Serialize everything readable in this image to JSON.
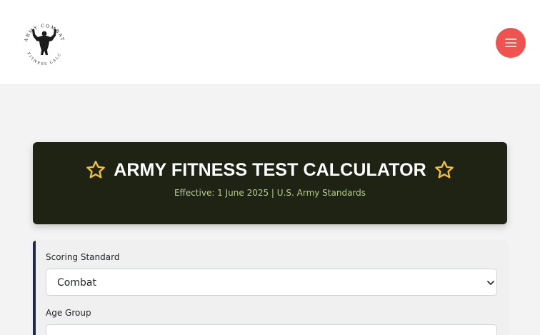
{
  "header": {
    "logo": {
      "icon": "bodybuilder-silhouette-icon",
      "arc_top_text": "ARMY COMBAT",
      "arc_bottom_text": "FITNESS CALC"
    },
    "menu_button": {
      "icon": "hamburger-menu-icon"
    }
  },
  "hero": {
    "title": "ARMY FITNESS TEST CALCULATOR",
    "subtitle": "Effective: 1 June 2025 | U.S. Army Standards",
    "icon": "star-outline-icon"
  },
  "form": {
    "scoring_standard": {
      "label": "Scoring Standard",
      "value": "Combat"
    },
    "age_group": {
      "label": "Age Group"
    }
  },
  "colors": {
    "hero_bg": "#1f2313",
    "star": "#f2c230",
    "subtitle": "#b7cf8a",
    "menu_button": "#ef5350",
    "form_accent": "#1f2a44",
    "page_bg": "#f3f3f3"
  }
}
